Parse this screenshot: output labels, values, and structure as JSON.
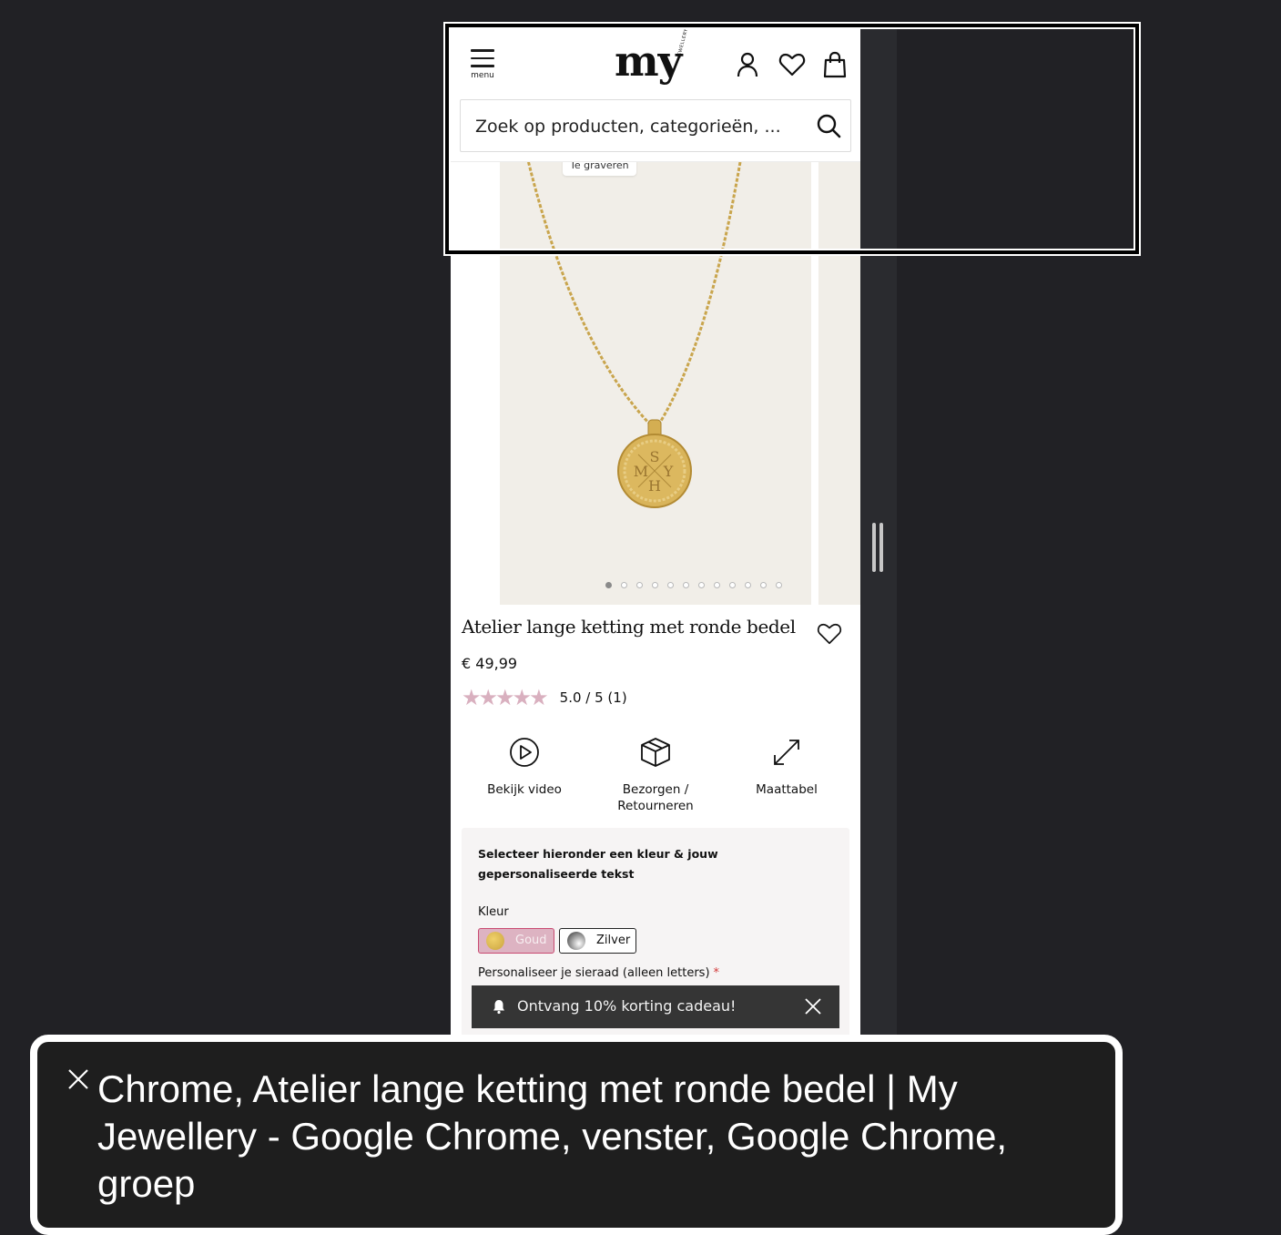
{
  "header": {
    "menu_label": "menu",
    "logo_text": "my",
    "logo_subtext": "JEWELLERY",
    "search_placeholder": "Zoek op producten, categorieën, ..."
  },
  "gallery": {
    "badge": "Te graveren",
    "image_count": 12,
    "active_index": 0,
    "engraving_letters": [
      "M",
      "S",
      "Y",
      "H"
    ]
  },
  "product": {
    "title": "Atelier lange ketting met ronde bedel",
    "price": "€ 49,99",
    "rating_stars": 5,
    "rating_text": "5.0 / 5 (1)",
    "star_color": "#d9b0bf"
  },
  "actions": [
    {
      "label": "Bekijk video",
      "icon": "play-circle-icon"
    },
    {
      "label": "Bezorgen / Retourneren",
      "icon": "package-box-icon"
    },
    {
      "label": "Maattabel",
      "icon": "expand-arrows-icon"
    }
  ],
  "personalise": {
    "heading": "Selecteer hieronder een kleur & jouw gepersonaliseerde tekst",
    "color_label": "Kleur",
    "colors": [
      {
        "label": "Goud",
        "selected": true
      },
      {
        "label": "Zilver",
        "selected": false
      }
    ],
    "field_label": "Personaliseer je sieraad (alleen letters)",
    "required_mark": "*"
  },
  "toast": {
    "text": "Ontvang 10% korting cadeau!"
  },
  "caption": {
    "text": "Chrome, Atelier lange ketting met ronde bedel | My Jewellery - Google Chrome, venster, Google Chrome, groep"
  },
  "colors": {
    "background": "#212125",
    "accent_pink": "#ddb3c2",
    "selected_border": "#c94a72",
    "toast_bg": "#353535"
  }
}
